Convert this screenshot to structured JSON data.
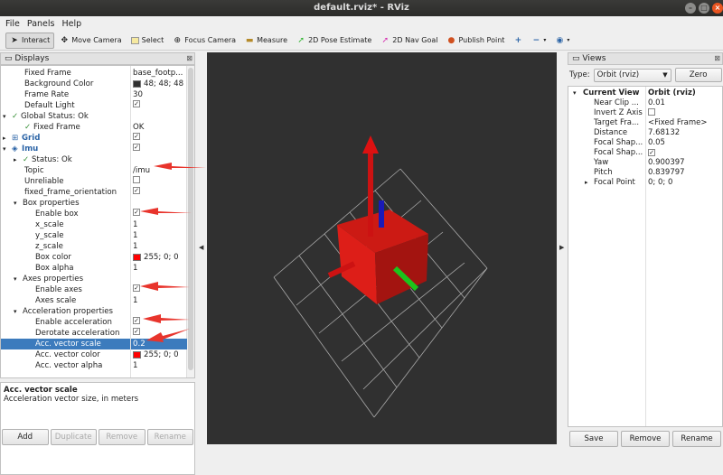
{
  "window": {
    "title": "default.rviz* - RViz"
  },
  "menu": [
    "File",
    "Panels",
    "Help"
  ],
  "toolbar": {
    "tools": [
      {
        "label": "Interact",
        "icon": "cursor-icon",
        "active": true
      },
      {
        "label": "Move Camera",
        "icon": "move-camera-icon"
      },
      {
        "label": "Select",
        "icon": "select-icon"
      },
      {
        "label": "Focus Camera",
        "icon": "focus-camera-icon"
      },
      {
        "label": "Measure",
        "icon": "ruler-icon"
      },
      {
        "label": "2D Pose Estimate",
        "icon": "green-arrow-icon"
      },
      {
        "label": "2D Nav Goal",
        "icon": "magenta-arrow-icon"
      },
      {
        "label": "Publish Point",
        "icon": "map-pin-icon"
      }
    ]
  },
  "displays": {
    "title": "Displays",
    "rows": [
      {
        "label": "Fixed Frame",
        "value": "base_footp...",
        "indent": 1
      },
      {
        "label": "Background Color",
        "value": "48; 48; 48",
        "swatch": "#303030",
        "indent": 1
      },
      {
        "label": "Frame Rate",
        "value": "30",
        "indent": 1
      },
      {
        "label": "Default Light",
        "check": true,
        "indent": 1
      },
      {
        "label": "Global Status: Ok",
        "expander": "▾",
        "status": true,
        "indent": 0
      },
      {
        "label": "Fixed Frame",
        "value": "OK",
        "status": true,
        "indent": 1
      },
      {
        "label": "Grid",
        "check": true,
        "expander": "▸",
        "blue": true,
        "icon": "grid-icon",
        "indent": 0
      },
      {
        "label": "Imu",
        "check": true,
        "expander": "▾",
        "blue": true,
        "icon": "imu-icon",
        "indent": 0
      },
      {
        "label": "Status: Ok",
        "expander": "▸",
        "status": true,
        "indent": 1
      },
      {
        "label": "Topic",
        "value": "/imu",
        "indent": 1
      },
      {
        "label": "Unreliable",
        "check": false,
        "indent": 1
      },
      {
        "label": "fixed_frame_orientation",
        "check": true,
        "indent": 1
      },
      {
        "label": "Box properties",
        "expander": "▾",
        "indent": 1
      },
      {
        "label": "Enable box",
        "check": true,
        "indent": 2
      },
      {
        "label": "x_scale",
        "value": "1",
        "indent": 2
      },
      {
        "label": "y_scale",
        "value": "1",
        "indent": 2
      },
      {
        "label": "z_scale",
        "value": "1",
        "indent": 2
      },
      {
        "label": "Box color",
        "value": "255; 0; 0",
        "swatch": "#ff0000",
        "indent": 2
      },
      {
        "label": "Box alpha",
        "value": "1",
        "indent": 2
      },
      {
        "label": "Axes properties",
        "expander": "▾",
        "indent": 1
      },
      {
        "label": "Enable axes",
        "check": true,
        "indent": 2
      },
      {
        "label": "Axes scale",
        "value": "1",
        "indent": 2
      },
      {
        "label": "Acceleration properties",
        "expander": "▾",
        "indent": 1
      },
      {
        "label": "Enable acceleration",
        "check": true,
        "indent": 2
      },
      {
        "label": "Derotate acceleration",
        "check": true,
        "indent": 2
      },
      {
        "label": "Acc. vector scale",
        "value": "0.2",
        "selected": true,
        "indent": 2
      },
      {
        "label": "Acc. vector color",
        "value": "255; 0; 0",
        "swatch": "#ff0000",
        "indent": 2
      },
      {
        "label": "Acc. vector alpha",
        "value": "1",
        "indent": 2
      }
    ],
    "help_title": "Acc. vector scale",
    "help_text": "Acceleration vector size, in meters",
    "buttons": [
      "Add",
      "Duplicate",
      "Remove",
      "Rename"
    ]
  },
  "views": {
    "title": "Views",
    "type_label": "Type:",
    "type_value": "Orbit (rviz)",
    "zero_label": "Zero",
    "rows": [
      {
        "label": "Current View",
        "value": "Orbit (rviz)",
        "head": true
      },
      {
        "label": "Near Clip ...",
        "value": "0.01"
      },
      {
        "label": "Invert Z Axis",
        "check": false
      },
      {
        "label": "Target Fra...",
        "value": "<Fixed Frame>"
      },
      {
        "label": "Distance",
        "value": "7.68132"
      },
      {
        "label": "Focal Shap...",
        "value": "0.05"
      },
      {
        "label": "Focal Shap...",
        "check": true
      },
      {
        "label": "Yaw",
        "value": "0.900397"
      },
      {
        "label": "Pitch",
        "value": "0.839797"
      },
      {
        "label": "Focal Point",
        "value": "0; 0; 0",
        "expander": "▸"
      }
    ],
    "buttons": [
      "Save",
      "Remove",
      "Rename"
    ]
  }
}
